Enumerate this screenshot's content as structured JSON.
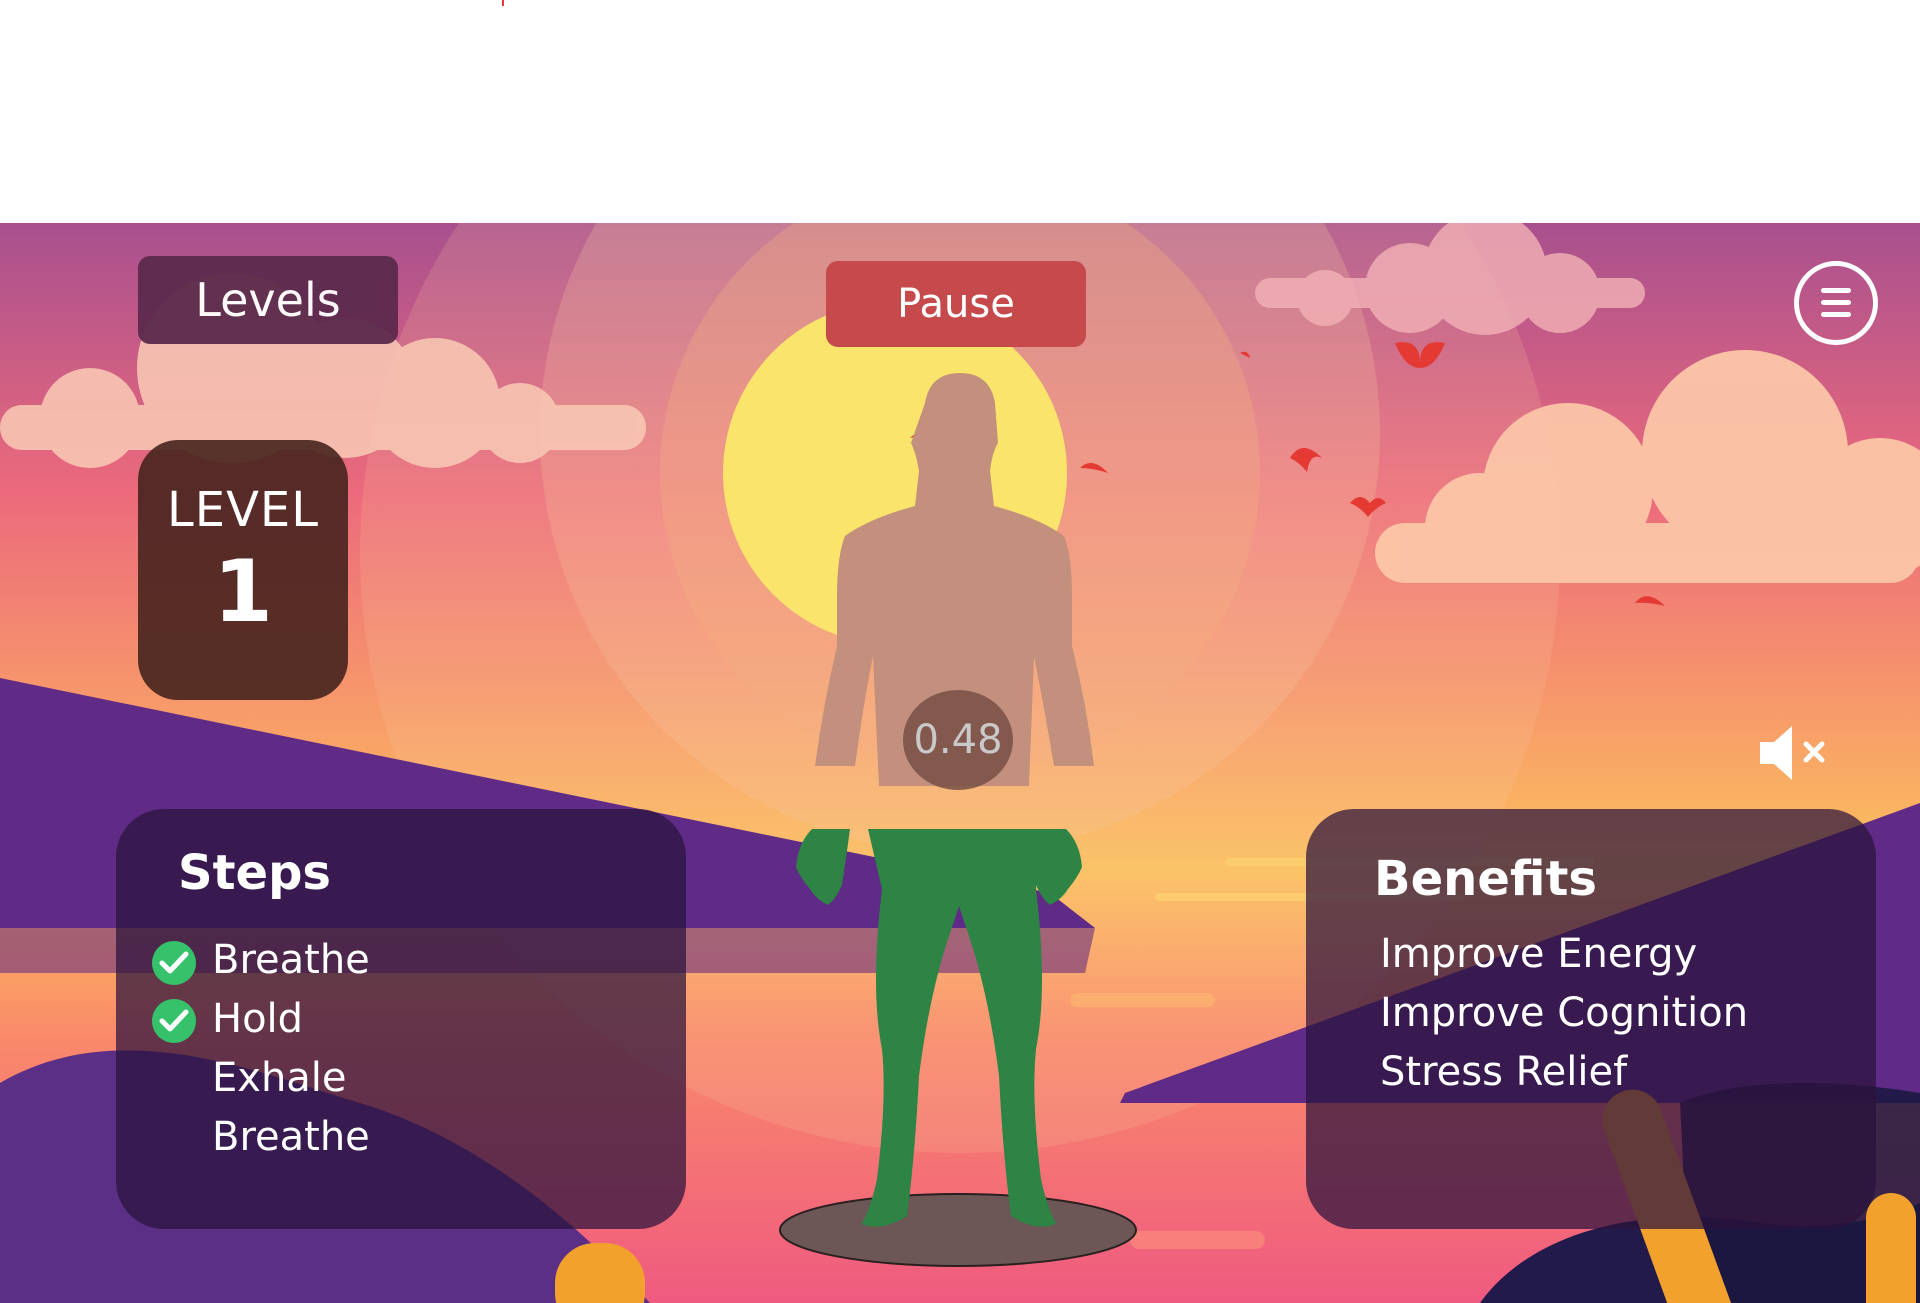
{
  "header": {
    "levels_label": "Levels",
    "pause_label": "Pause"
  },
  "level": {
    "label": "LEVEL",
    "number": "1"
  },
  "timer": {
    "value": "0.48"
  },
  "steps": {
    "title": "Steps",
    "items": [
      {
        "label": "Breathe",
        "done": true
      },
      {
        "label": "Hold",
        "done": true
      },
      {
        "label": "Exhale",
        "done": false
      },
      {
        "label": "Breathe",
        "done": false
      }
    ]
  },
  "benefits": {
    "title": "Benefits",
    "items": [
      "Improve Energy",
      "Improve Cognition",
      "Stress Relief"
    ]
  },
  "icons": {
    "menu": "hamburger-menu-icon",
    "sound": "speaker-muted-icon",
    "check": "check-circle-icon"
  },
  "colors": {
    "pause": "#c64a4c",
    "levels": "#5c2a4c",
    "check": "#35c26b",
    "body_active": "#2e8444"
  }
}
